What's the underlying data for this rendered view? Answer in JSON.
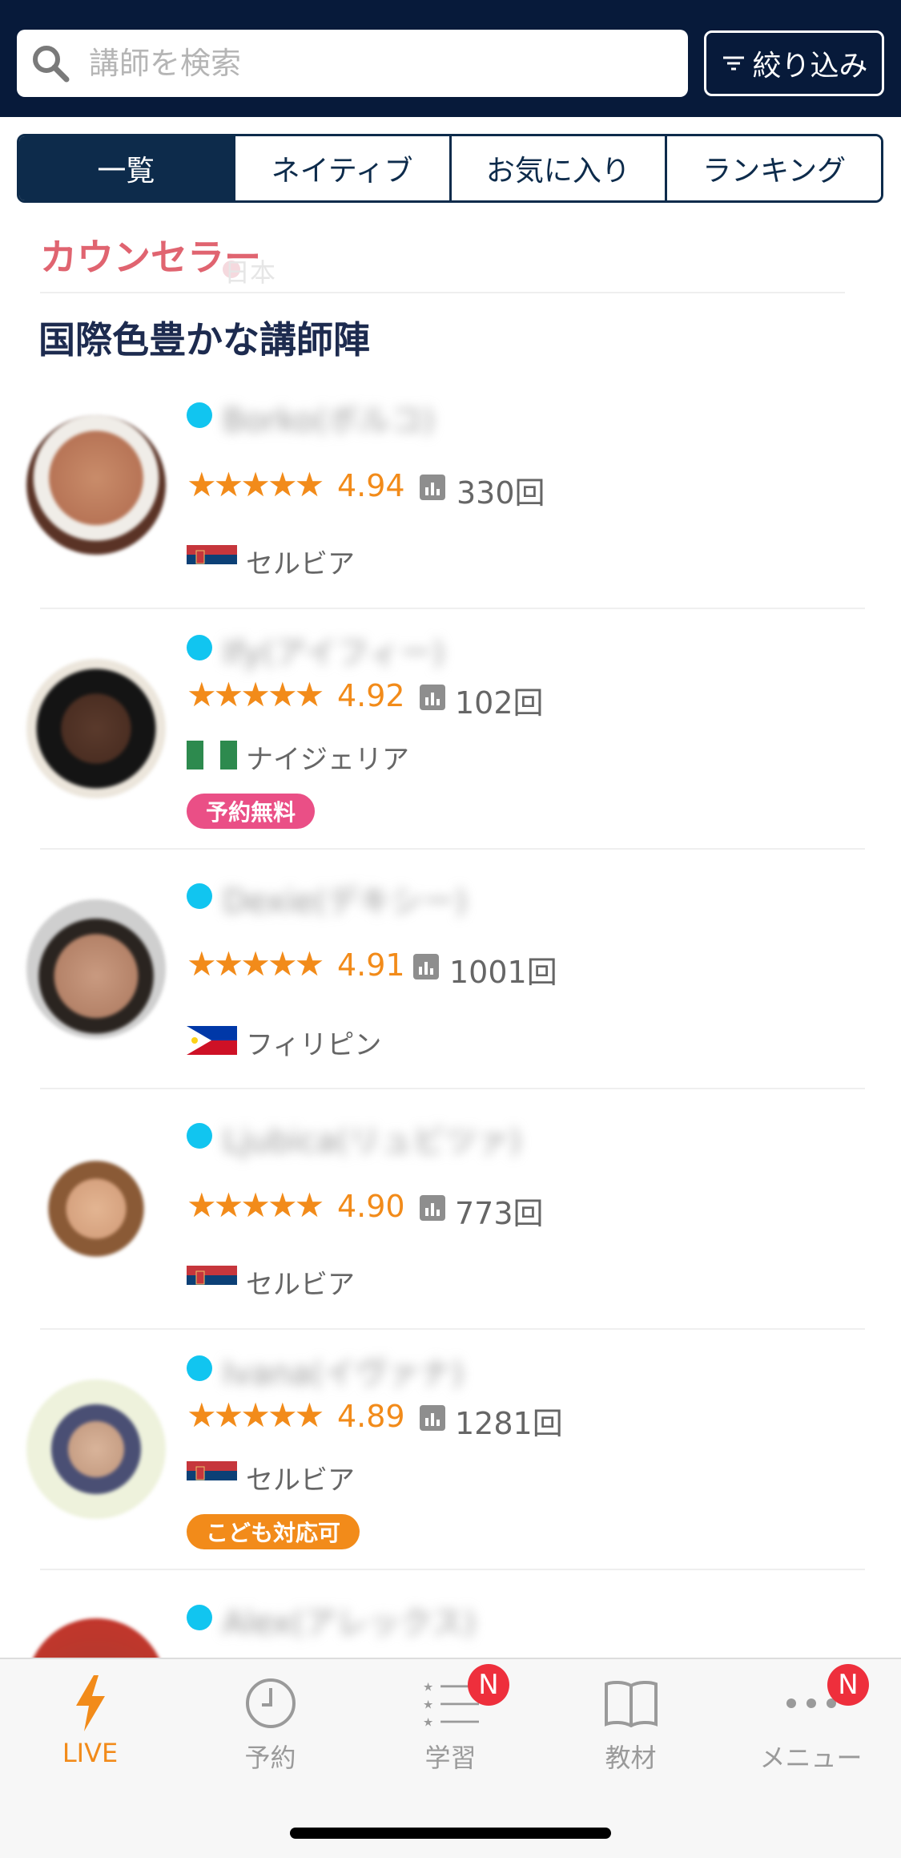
{
  "search": {
    "placeholder": "講師を検索",
    "value": ""
  },
  "filter": {
    "label": "絞り込み"
  },
  "tabs": [
    {
      "label": "一覧",
      "active": true
    },
    {
      "label": "ネイティブ",
      "active": false
    },
    {
      "label": "お気に入り",
      "active": false
    },
    {
      "label": "ランキング",
      "active": false
    }
  ],
  "counselor": {
    "title": "カウンセラー",
    "ghost_country": "日本"
  },
  "section": {
    "title": "国際色豊かな講師陣"
  },
  "teachers": [
    {
      "name": "Borko(ボルコ)",
      "stars": "★★★★★",
      "rating": "4.94",
      "count": "330回",
      "country": "セルビア",
      "flag": "serbia",
      "badge": ""
    },
    {
      "name": "Ify(アイフィー)",
      "stars": "★★★★★",
      "rating": "4.92",
      "count": "102回",
      "country": "ナイジェリア",
      "flag": "nigeria",
      "badge": "予約無料"
    },
    {
      "name": "Dexie(デキシー)",
      "stars": "★★★★★",
      "rating": "4.91",
      "count": "1001回",
      "country": "フィリピン",
      "flag": "philippines",
      "badge": ""
    },
    {
      "name": "Ljubica(リュビツァ)",
      "stars": "★★★★★",
      "rating": "4.90",
      "count": "773回",
      "country": "セルビア",
      "flag": "serbia",
      "badge": ""
    },
    {
      "name": "Ivana(イヴァナ)",
      "stars": "★★★★★",
      "rating": "4.89",
      "count": "1281回",
      "country": "セルビア",
      "flag": "serbia",
      "badge": "こども対応可"
    },
    {
      "name": "Alex(アレックス)",
      "stars": "",
      "rating": "",
      "count": "",
      "country": "",
      "flag": "",
      "badge": ""
    }
  ],
  "nav": [
    {
      "label": "LIVE",
      "icon": "bolt-icon",
      "active": true,
      "badge": ""
    },
    {
      "label": "予約",
      "icon": "clock-icon",
      "active": false,
      "badge": ""
    },
    {
      "label": "学習",
      "icon": "list-icon",
      "active": false,
      "badge": "N"
    },
    {
      "label": "教材",
      "icon": "book-icon",
      "active": false,
      "badge": ""
    },
    {
      "label": "メニュー",
      "icon": "more-icon",
      "active": false,
      "badge": "N"
    }
  ],
  "colors": {
    "header": "#071a3a",
    "accent": "#f28b1a",
    "online": "#11c5f0",
    "counselor": "#e06470",
    "badge_pink": "#ea4f86",
    "notify": "#ee2f3c"
  }
}
